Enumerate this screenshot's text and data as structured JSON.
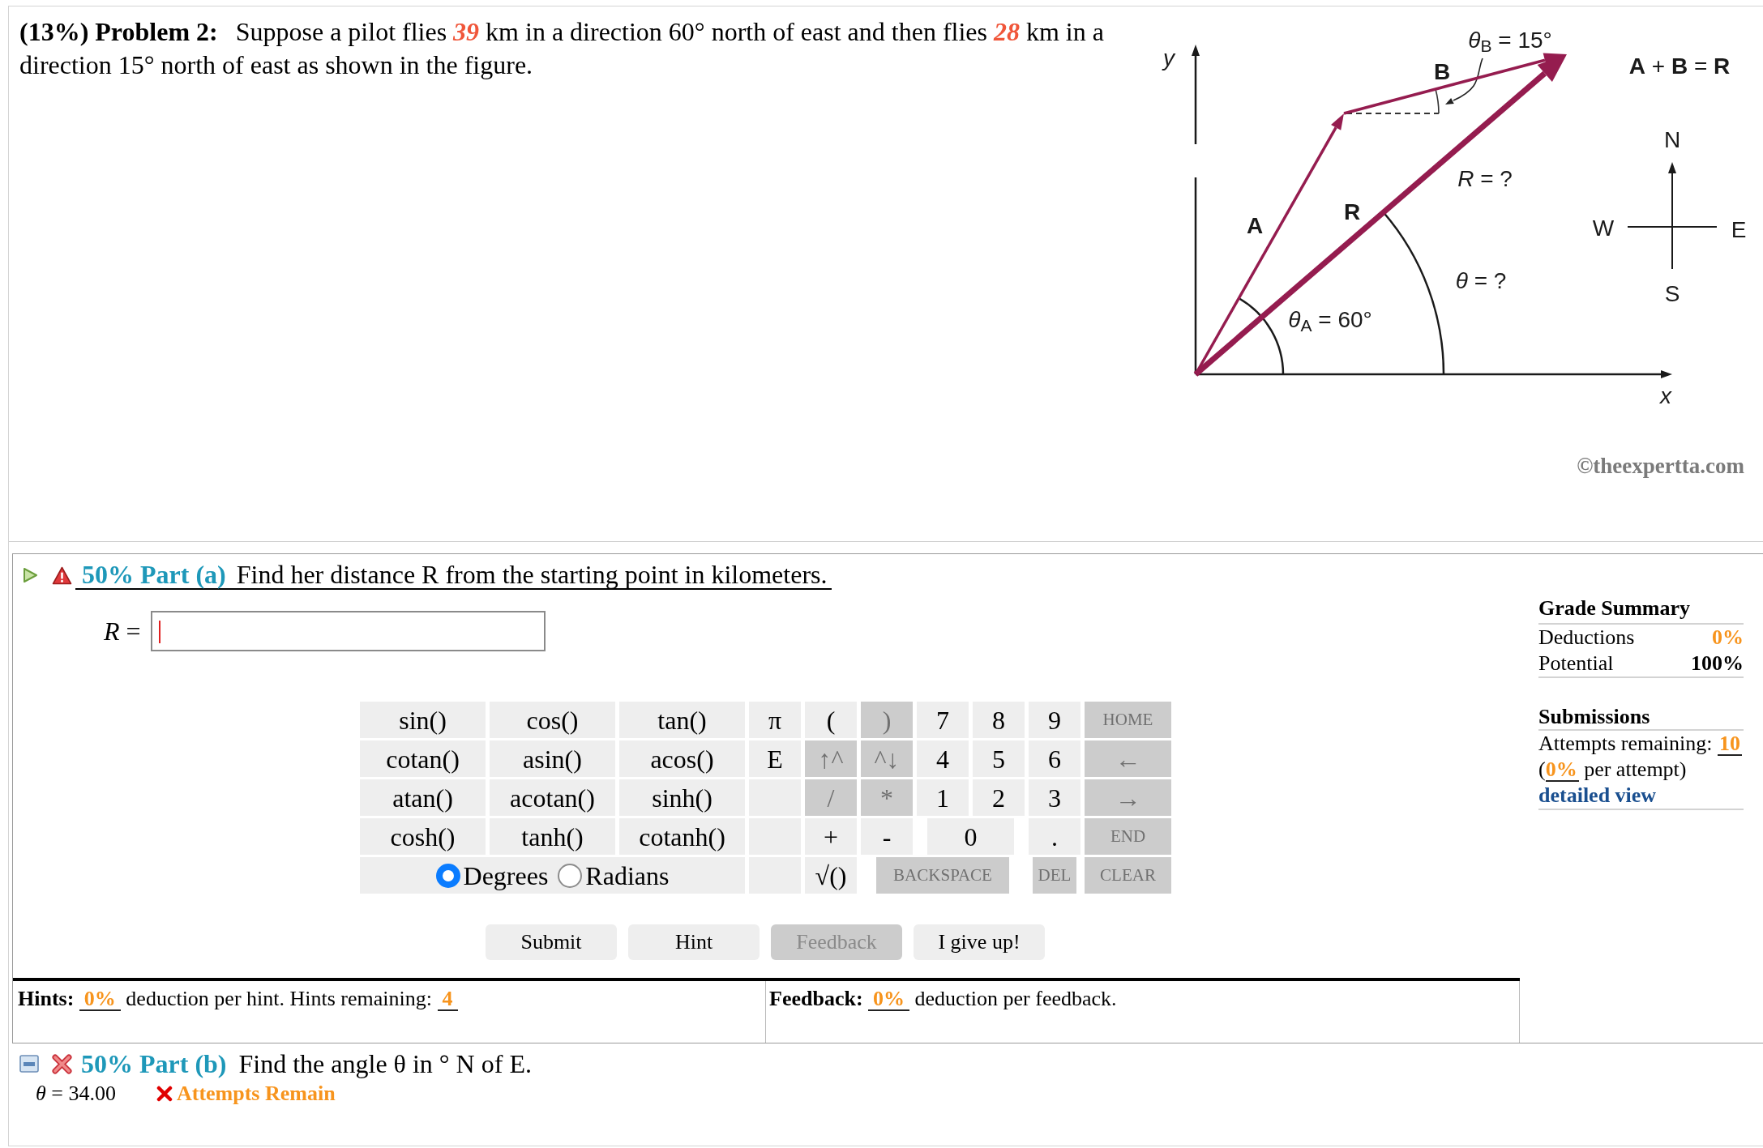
{
  "problem": {
    "heading": "(13%) Problem 2:",
    "segments": [
      {
        "kind": "plain",
        "text": "Suppose a pilot flies "
      },
      {
        "kind": "given",
        "text": "39"
      },
      {
        "kind": "plain",
        "text": " km in a direction 60° north of east and then flies "
      },
      {
        "kind": "given",
        "text": "28"
      },
      {
        "kind": "plain",
        "text": " km in a direction 15° north of east as shown in the figure."
      }
    ]
  },
  "figure": {
    "labels": [
      {
        "kind": "angle",
        "text": "*θ*$_{B}$ = 15°"
      },
      {
        "kind": "axis",
        "text": "y"
      },
      {
        "kind": "vector",
        "text": "B"
      },
      {
        "kind": "equation",
        "text": "**A** + **B** = **R**"
      },
      {
        "kind": "compass",
        "text": "N"
      },
      {
        "kind": "unknown",
        "text": "*R* = ?"
      },
      {
        "kind": "vector",
        "text": "R"
      },
      {
        "kind": "vector",
        "text": "A"
      },
      {
        "kind": "compass",
        "text": "W"
      },
      {
        "kind": "compass",
        "text": "E"
      },
      {
        "kind": "unknown",
        "text": "*θ* = ?"
      },
      {
        "kind": "compass",
        "text": "S"
      },
      {
        "kind": "angle",
        "text": "*θ*$_{A}$ = 60°"
      },
      {
        "kind": "axis",
        "text": "x"
      }
    ],
    "copyright": "©theexpertta.com"
  },
  "part_a": {
    "label": "50% Part (a)",
    "question": "Find her distance R from the starting point in kilometers.",
    "answer_field": {
      "label": "*R* =",
      "focused": true
    },
    "keypad": {
      "rows": [
        [
          {
            "kind": "key",
            "label": "sin()",
            "disabled": false
          },
          {
            "kind": "key",
            "label": "cos()",
            "disabled": false
          },
          {
            "kind": "key",
            "label": "tan()",
            "disabled": false
          },
          {
            "kind": "key",
            "label": "π",
            "disabled": false
          },
          {
            "kind": "key",
            "label": "(",
            "disabled": false
          },
          {
            "kind": "key",
            "label": ")",
            "disabled": true
          },
          {
            "kind": "key",
            "label": "7",
            "disabled": false
          },
          {
            "kind": "key",
            "label": "8",
            "disabled": false
          },
          {
            "kind": "key",
            "label": "9",
            "disabled": false
          },
          {
            "kind": "command",
            "label": "HOME",
            "disabled": true
          }
        ],
        [
          {
            "kind": "key",
            "label": "cotan()",
            "disabled": false
          },
          {
            "kind": "key",
            "label": "asin()",
            "disabled": false
          },
          {
            "kind": "key",
            "label": "acos()",
            "disabled": false
          },
          {
            "kind": "key",
            "label": "E",
            "disabled": false
          },
          {
            "kind": "key",
            "label": "↑^",
            "disabled": true
          },
          {
            "kind": "key",
            "label": "^↓",
            "disabled": true
          },
          {
            "kind": "key",
            "label": "4",
            "disabled": false
          },
          {
            "kind": "key",
            "label": "5",
            "disabled": false
          },
          {
            "kind": "key",
            "label": "6",
            "disabled": false
          },
          {
            "kind": "key",
            "label": "←",
            "disabled": true
          }
        ],
        [
          {
            "kind": "key",
            "label": "atan()",
            "disabled": false
          },
          {
            "kind": "key",
            "label": "acotan()",
            "disabled": false
          },
          {
            "kind": "key",
            "label": "sinh()",
            "disabled": false
          },
          {
            "kind": "blank"
          },
          {
            "kind": "key",
            "label": "/",
            "disabled": true
          },
          {
            "kind": "key",
            "label": "*",
            "disabled": true
          },
          {
            "kind": "key",
            "label": "1",
            "disabled": false
          },
          {
            "kind": "key",
            "label": "2",
            "disabled": false
          },
          {
            "kind": "key",
            "label": "3",
            "disabled": false
          },
          {
            "kind": "key",
            "label": "→",
            "disabled": true
          }
        ],
        [
          {
            "kind": "key",
            "label": "cosh()",
            "disabled": false
          },
          {
            "kind": "key",
            "label": "tanh()",
            "disabled": false
          },
          {
            "kind": "key",
            "label": "cotanh()",
            "disabled": false
          },
          {
            "kind": "blank"
          },
          {
            "kind": "key",
            "label": "+",
            "disabled": false
          },
          {
            "kind": "key",
            "label": "-",
            "disabled": false
          },
          {
            "kind": "key",
            "label": "0",
            "disabled": false
          },
          {
            "kind": "gap"
          },
          {
            "kind": "key",
            "label": ".",
            "disabled": false
          },
          {
            "kind": "command",
            "label": "END",
            "disabled": true
          }
        ],
        [
          {
            "kind": "gap"
          },
          {
            "kind": "units",
            "options": [
              {
                "label": "Degrees",
                "selected": true
              },
              {
                "label": "Radians",
                "selected": false
              }
            ]
          },
          {
            "kind": "gap"
          },
          {
            "kind": "blank"
          },
          {
            "kind": "key",
            "label": "√()",
            "disabled": false
          },
          {
            "kind": "gap"
          },
          {
            "kind": "command",
            "label": "BACKSPACE",
            "disabled": true
          },
          {
            "kind": "gap"
          },
          {
            "kind": "command",
            "label": "DEL",
            "disabled": true
          },
          {
            "kind": "command",
            "label": "CLEAR",
            "disabled": true
          }
        ]
      ]
    },
    "buttons": [
      {
        "label": "Submit",
        "disabled": false
      },
      {
        "label": "Hint",
        "disabled": false
      },
      {
        "label": "Feedback",
        "disabled": true
      },
      {
        "label": "I give up!",
        "disabled": false
      }
    ],
    "hints": {
      "label": "Hints:",
      "deduction": "0%",
      "text": "deduction per hint. Hints remaining:",
      "remaining": "4"
    },
    "feedback": {
      "label": "Feedback:",
      "deduction": "0%",
      "text": "deduction per feedback."
    }
  },
  "grade_summary": {
    "title": "Grade Summary",
    "rows": [
      {
        "kind": "deduction",
        "label": "Deductions",
        "value": "0%"
      },
      {
        "kind": "potential",
        "label": "Potential",
        "value": "100%"
      }
    ]
  },
  "submissions": {
    "title": "Submissions",
    "attempts_label": "Attempts remaining:",
    "attempts": "10",
    "per_attempt": {
      "prefix": "(",
      "value": "0%",
      "suffix": "per attempt)"
    },
    "link": "detailed view"
  },
  "part_b": {
    "label": "50% Part (b)",
    "question": "Find the angle θ in ° N of E.",
    "answer": "*θ* = 34.00",
    "status": "Attempts Remain"
  }
}
